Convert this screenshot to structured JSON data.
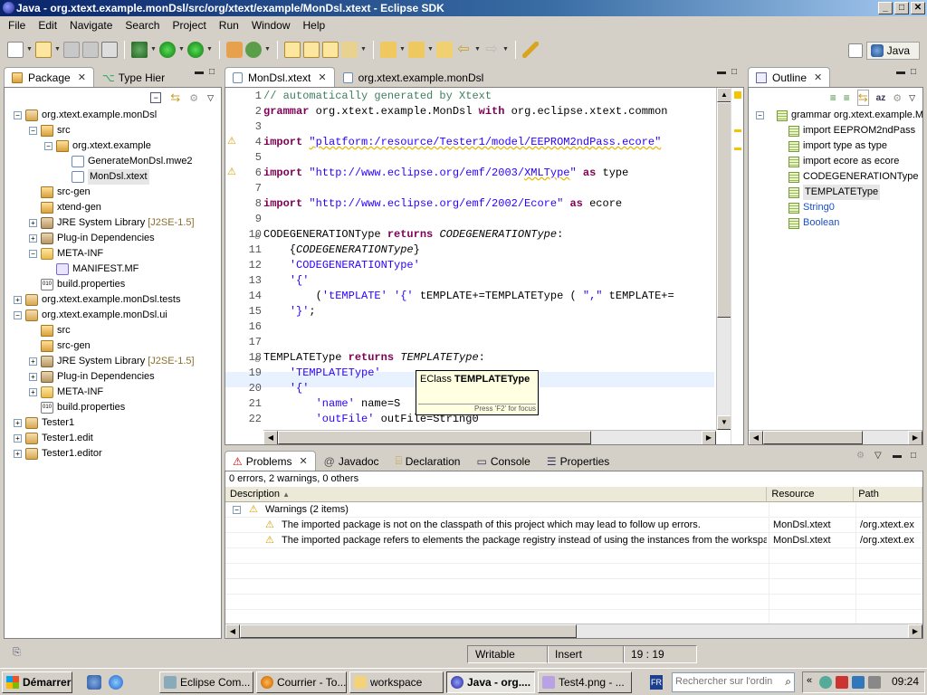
{
  "window": {
    "title": "Java - org.xtext.example.monDsl/src/org/xtext/example/MonDsl.xtext - Eclipse SDK",
    "min": "_",
    "max": "□",
    "close": "✕"
  },
  "menu": [
    "File",
    "Edit",
    "Navigate",
    "Search",
    "Project",
    "Run",
    "Window",
    "Help"
  ],
  "perspective": {
    "label": "Java"
  },
  "package_explorer": {
    "tabs": [
      "Package",
      "Type Hier"
    ],
    "tree": [
      {
        "label": "org.xtext.example.monDsl",
        "icon": "project",
        "depth": 0,
        "expander": "−"
      },
      {
        "label": "src",
        "icon": "src-folder",
        "depth": 1,
        "expander": "−"
      },
      {
        "label": "org.xtext.example",
        "icon": "package",
        "depth": 2,
        "expander": "−"
      },
      {
        "label": "GenerateMonDsl.mwe2",
        "icon": "file",
        "depth": 3,
        "expander": ""
      },
      {
        "label": "MonDsl.xtext",
        "icon": "file",
        "depth": 3,
        "expander": "",
        "selected": true
      },
      {
        "label": "src-gen",
        "icon": "src-folder",
        "depth": 1,
        "expander": ""
      },
      {
        "label": "xtend-gen",
        "icon": "src-folder",
        "depth": 1,
        "expander": ""
      },
      {
        "label": "JRE System Library",
        "tag": "[J2SE-1.5]",
        "icon": "library",
        "depth": 1,
        "expander": "+"
      },
      {
        "label": "Plug-in Dependencies",
        "icon": "library",
        "depth": 1,
        "expander": "+"
      },
      {
        "label": "META-INF",
        "icon": "folder",
        "depth": 1,
        "expander": "−"
      },
      {
        "label": "MANIFEST.MF",
        "icon": "manifest",
        "depth": 2,
        "expander": ""
      },
      {
        "label": "build.properties",
        "icon": "properties",
        "depth": 1,
        "expander": ""
      },
      {
        "label": "org.xtext.example.monDsl.tests",
        "icon": "project",
        "depth": 0,
        "expander": "+"
      },
      {
        "label": "org.xtext.example.monDsl.ui",
        "icon": "project",
        "depth": 0,
        "expander": "−"
      },
      {
        "label": "src",
        "icon": "src-folder",
        "depth": 1,
        "expander": ""
      },
      {
        "label": "src-gen",
        "icon": "src-folder",
        "depth": 1,
        "expander": ""
      },
      {
        "label": "JRE System Library",
        "tag": "[J2SE-1.5]",
        "icon": "library",
        "depth": 1,
        "expander": "+"
      },
      {
        "label": "Plug-in Dependencies",
        "icon": "library",
        "depth": 1,
        "expander": "+"
      },
      {
        "label": "META-INF",
        "icon": "folder",
        "depth": 1,
        "expander": "+"
      },
      {
        "label": "build.properties",
        "icon": "properties",
        "depth": 1,
        "expander": ""
      },
      {
        "label": "Tester1",
        "icon": "project",
        "depth": 0,
        "expander": "+"
      },
      {
        "label": "Tester1.edit",
        "icon": "project",
        "depth": 0,
        "expander": "+"
      },
      {
        "label": "Tester1.editor",
        "icon": "project",
        "depth": 0,
        "expander": "+"
      }
    ]
  },
  "editor": {
    "tabs": [
      "MonDsl.xtext",
      "org.xtext.example.monDsl"
    ],
    "lines": [
      {
        "n": "1",
        "html": "<span class='cm'>// automatically generated by Xtext</span>"
      },
      {
        "n": "2",
        "html": "<span class='kw'>grammar</span> org.xtext.example.MonDsl <span class='kw'>with</span> org.eclipse.xtext.common"
      },
      {
        "n": "3",
        "html": ""
      },
      {
        "n": "4",
        "html": "<span class='kw'>import</span> <span class='str warnline'>\"platform:/resource/Tester1/model/EEPROM2ndPass.ecore\"</span>"
      },
      {
        "n": "5",
        "html": ""
      },
      {
        "n": "6",
        "html": "<span class='kw'>import</span> <span class='str'>\"http://www.eclipse.org/emf/2003/<span class='warnline'>XMLType</span>\"</span> <span class='kw'>as</span> type"
      },
      {
        "n": "7",
        "html": ""
      },
      {
        "n": "8",
        "html": "<span class='kw'>import</span> <span class='str'>\"http://www.eclipse.org/emf/2002/Ecore\"</span> <span class='kw'>as</span> ecore"
      },
      {
        "n": "9",
        "html": ""
      },
      {
        "n": "10",
        "html": "CODEGENERATIONType <span class='kw'>returns</span> <span class='it'>CODEGENERATIONType</span>:"
      },
      {
        "n": "11",
        "html": "    {<span class='it'>CODEGENERATIONType</span>}"
      },
      {
        "n": "12",
        "html": "    <span class='str'>'CODEGENERATIONType'</span>"
      },
      {
        "n": "13",
        "html": "    <span class='str'>'{'</span>"
      },
      {
        "n": "14",
        "html": "        (<span class='str'>'tEMPLATE'</span> <span class='str'>'{'</span> tEMPLATE+=TEMPLATEType ( <span class='str'>\",\"</span> tEMPLATE+="
      },
      {
        "n": "15",
        "html": "    <span class='str'>'}'</span>;"
      },
      {
        "n": "16",
        "html": ""
      },
      {
        "n": "17",
        "html": ""
      },
      {
        "n": "18",
        "html": "TEMPLATEType <span class='kw'>returns</span> <span class='it'>TEMPLATEType</span>:"
      },
      {
        "n": "19",
        "html": "    <span class='str'>'TEMPLATEType'</span>"
      },
      {
        "n": "20",
        "html": "    <span class='str'>'{'</span>"
      },
      {
        "n": "21",
        "html": "        <span class='str'>'name'</span> name=S"
      },
      {
        "n": "22",
        "html": "        <span class='str'>'outFile'</span> outFile=String0"
      }
    ],
    "tooltip": {
      "prefix": "EClass",
      "name": "TEMPLATEType",
      "hint": "Press 'F2' for focus"
    }
  },
  "outline": {
    "tab": "Outline",
    "items": [
      {
        "label": "grammar org.xtext.example.M",
        "root": true
      },
      {
        "label": "import EEPROM2ndPass"
      },
      {
        "label": "import type as type"
      },
      {
        "label": "import ecore as ecore"
      },
      {
        "label": "CODEGENERATIONType"
      },
      {
        "label": "TEMPLATEType",
        "selected": true
      },
      {
        "label": "String0",
        "link": true
      },
      {
        "label": "Boolean",
        "link": true
      }
    ]
  },
  "bottom": {
    "tabs": [
      "Problems",
      "Javadoc",
      "Declaration",
      "Console",
      "Properties"
    ],
    "summary": "0 errors, 2 warnings, 0 others",
    "columns": [
      "Description",
      "Resource",
      "Path"
    ],
    "group": "Warnings (2 items)",
    "rows": [
      {
        "description": "The imported package is not on the classpath of this project which may lead to follow up errors.",
        "resource": "MonDsl.xtext",
        "path": "/org.xtext.ex"
      },
      {
        "description": "The imported package refers to elements the package registry instead of using the instances from the workspac",
        "resource": "MonDsl.xtext",
        "path": "/org.xtext.ex"
      }
    ]
  },
  "status": {
    "writable": "Writable",
    "insert": "Insert",
    "position": "19 : 19"
  },
  "taskbar": {
    "start": "Démarrer",
    "items": [
      "Eclipse Com...",
      "Courrier - To...",
      "workspace",
      "Java - org....",
      "Test4.png - ..."
    ],
    "search_placeholder": "Rechercher sur l'ordin",
    "lang": "FR",
    "clock": "09:24"
  }
}
